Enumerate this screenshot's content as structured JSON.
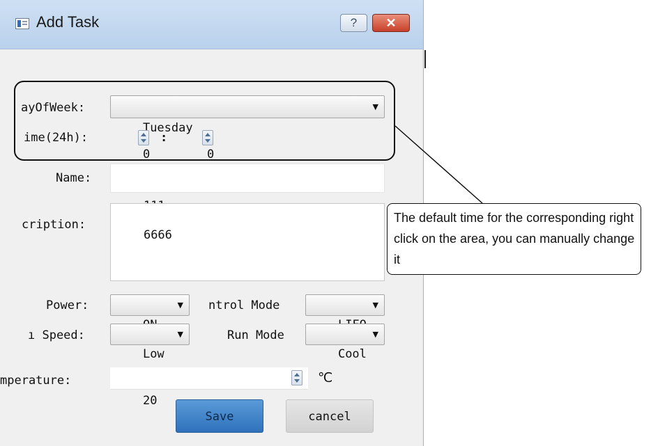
{
  "dialog": {
    "title": "Add Task",
    "help_label": "?",
    "close_label": "✕"
  },
  "form": {
    "day_of_week": {
      "label": "ayOfWeek:",
      "value": "Tuesday"
    },
    "time": {
      "label": "ime(24h):",
      "hour": "0",
      "separator": ":",
      "minute": "0"
    },
    "name": {
      "label": "Name:",
      "value": "111"
    },
    "description": {
      "label": "cription:",
      "value": "6666"
    },
    "power": {
      "label": "Power:",
      "value": "ON"
    },
    "control_mode": {
      "label": "ntrol Mode",
      "value": "LIFO"
    },
    "fan_speed": {
      "label": "ı Speed:",
      "value": "Low"
    },
    "run_mode": {
      "label": "Run Mode",
      "value": "Cool"
    },
    "temperature": {
      "label": "mperature:",
      "value": "20",
      "unit": "℃"
    }
  },
  "buttons": {
    "save_label": "Save",
    "cancel_label": "cancel"
  },
  "annotation": {
    "callout_text": "The default time for the corresponding right click on the area, you can manually change it"
  },
  "colors": {
    "titlebar": "#c3d8ef",
    "save_button": "#3a7fc6",
    "close_button": "#c8402a",
    "dialog_bg": "#f0f0f0"
  }
}
